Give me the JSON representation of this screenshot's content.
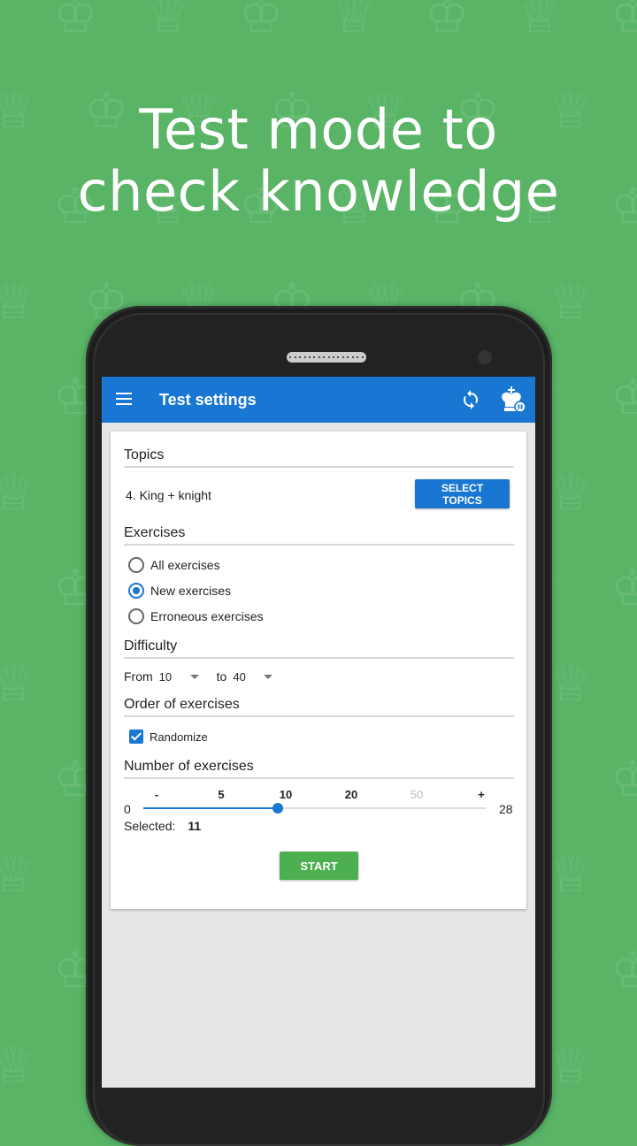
{
  "headline": {
    "line1": "Test mode to",
    "line2": "check knowledge"
  },
  "app": {
    "title": "Test settings",
    "icons": {
      "menu": "menu-icon",
      "sync": "sync-icon",
      "app_logo": "king-icon"
    },
    "colors": {
      "primary": "#1976d2",
      "start": "#4caf50",
      "background": "#59b466"
    }
  },
  "topics": {
    "title": "Topics",
    "selected": "4. King + knight",
    "button": "SELECT TOPICS"
  },
  "exercises": {
    "title": "Exercises",
    "options": [
      {
        "label": "All exercises",
        "checked": false
      },
      {
        "label": "New exercises",
        "checked": true
      },
      {
        "label": "Erroneous exercises",
        "checked": false
      }
    ]
  },
  "difficulty": {
    "title": "Difficulty",
    "from_label": "From",
    "from_value": "10",
    "to_label": "to",
    "to_value": "40"
  },
  "order": {
    "title": "Order of exercises",
    "randomize_label": "Randomize",
    "randomize_checked": true
  },
  "number": {
    "title": "Number of exercises",
    "presets": [
      "-",
      "5",
      "10",
      "20",
      "50",
      "+"
    ],
    "disabled_presets": [
      "50"
    ],
    "min": "0",
    "max": "28",
    "value": 11,
    "selected_label": "Selected:",
    "selected_value": "11"
  },
  "start_button": "START"
}
